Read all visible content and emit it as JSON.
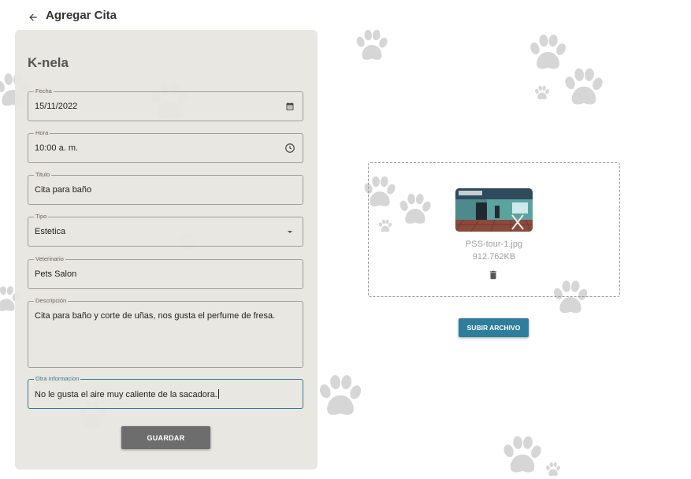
{
  "header": {
    "title": "Agregar Cita",
    "back_icon": "arrow-left-icon"
  },
  "form": {
    "pet_name": "K-nela",
    "fields": [
      {
        "label": "Fecha",
        "value": "15/11/2022",
        "icon": "calendar-icon"
      },
      {
        "label": "Hora",
        "value": "10:00 a. m.",
        "icon": "clock-icon"
      },
      {
        "label": "Titulo",
        "value": "Cita para baño"
      },
      {
        "label": "Tipo",
        "value": "Estetica",
        "icon": "dropdown-arrow-icon"
      },
      {
        "label": "Veterinario",
        "value": "Pets Salon"
      },
      {
        "label": "Descripción",
        "value": "Cita para baño y corte de uñas, nos gusta el perfume de fresa."
      },
      {
        "label": "Otra informacion",
        "value": "No le gusta el aire muy caliente de la sacadora."
      }
    ],
    "save_label": "GUARDAR"
  },
  "upload": {
    "file_name": "PSS-tour-1.jpg",
    "file_size": "912.762KB",
    "delete_icon": "trash-icon",
    "upload_label": "SUBIR ARCHIVO"
  },
  "colors": {
    "accent": "#2e7d9a",
    "card_bg": "#e8e5df",
    "paw": "#d6d6d6",
    "save_button": "#6d6d6d"
  }
}
